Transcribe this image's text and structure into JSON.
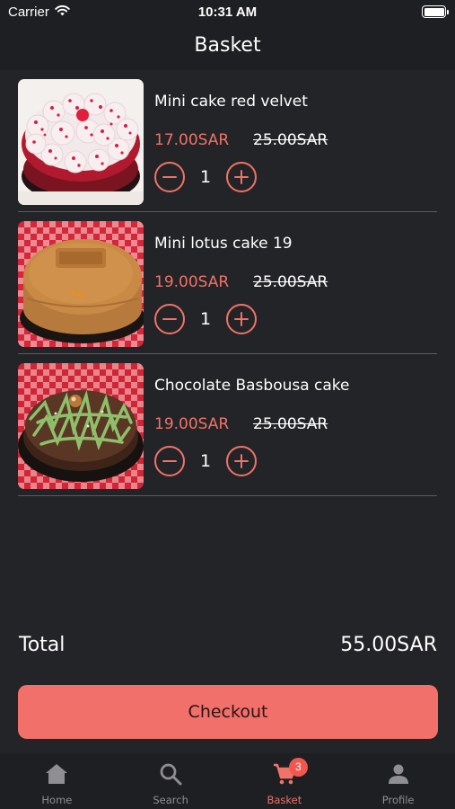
{
  "status_bar": {
    "carrier": "Carrier",
    "time": "10:31 AM",
    "wifi_icon": "wifi-icon",
    "battery_icon": "battery-icon"
  },
  "header": {
    "title": "Basket"
  },
  "basket": {
    "items": [
      {
        "name": "Mini cake red velvet",
        "price": "17.00SAR",
        "old_price": "25.00SAR",
        "quantity": "1",
        "image": "red-velvet-cake-photo"
      },
      {
        "name": "Mini lotus cake 19",
        "price": "19.00SAR",
        "old_price": "25.00SAR",
        "quantity": "1",
        "image": "lotus-cake-photo"
      },
      {
        "name": "Chocolate Basbousa cake",
        "price": "19.00SAR",
        "old_price": "25.00SAR",
        "quantity": "1",
        "image": "chocolate-basbousa-cake-photo"
      }
    ]
  },
  "summary": {
    "total_label": "Total",
    "total_value": "55.00SAR"
  },
  "checkout": {
    "label": "Checkout"
  },
  "tabbar": {
    "tabs": [
      {
        "label": "Home",
        "icon": "home-icon",
        "active": false
      },
      {
        "label": "Search",
        "icon": "search-icon",
        "active": false
      },
      {
        "label": "Basket",
        "icon": "cart-icon",
        "active": true,
        "badge": "3"
      },
      {
        "label": "Profile",
        "icon": "person-icon",
        "active": false
      }
    ]
  },
  "colors": {
    "background": "#232427",
    "bars": "#1e1f22",
    "accent": "#f07268",
    "checkout_button": "#f1706a",
    "divider": "#5b5c60",
    "inactive_tab": "#8e8e93",
    "badge": "#f2574f"
  }
}
